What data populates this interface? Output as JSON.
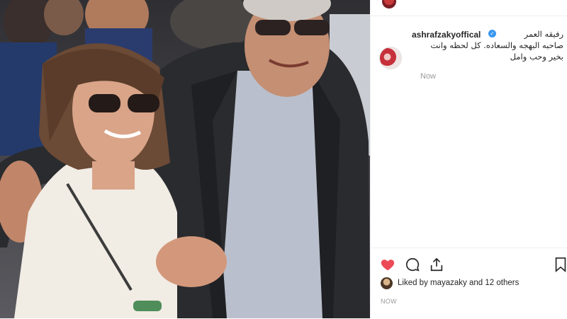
{
  "top": {
    "username": ""
  },
  "comment": {
    "username": "ashrafzakyoffical",
    "text_lines": [
      "رفيقه العمر",
      "صاحبه البهجه والسعاده. كل لحظه وانت",
      "بخير وحب وامل"
    ],
    "time": "Now"
  },
  "actions": {
    "likes_text": "Liked by mayazaky and 12 others",
    "post_time": "NOW"
  },
  "icons": [
    "heart-icon",
    "comment-icon",
    "share-icon",
    "save-icon",
    "verified-badge-icon"
  ],
  "colors": {
    "like": "#ed4956",
    "verified": "#3897f0",
    "muted": "#999999"
  }
}
